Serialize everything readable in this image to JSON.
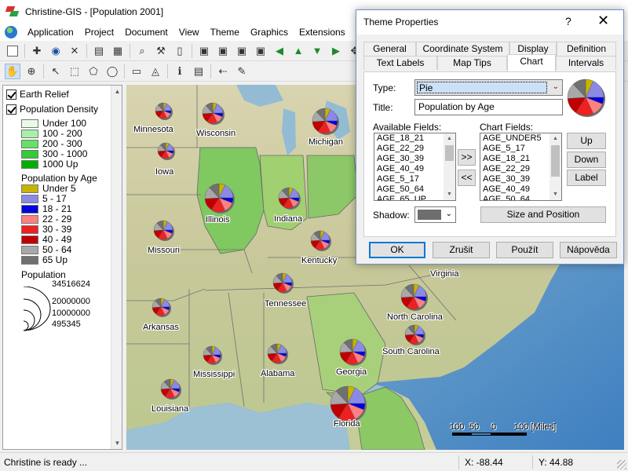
{
  "window": {
    "title": "Christine-GIS - [Population 2001]"
  },
  "menu": [
    "Application",
    "Project",
    "Document",
    "View",
    "Theme",
    "Graphics",
    "Extensions",
    "W"
  ],
  "legend": {
    "layers": [
      {
        "label": "Earth Relief",
        "checked": true
      },
      {
        "label": "Population Density",
        "checked": true
      }
    ],
    "density_classes": [
      {
        "label": "Under 100",
        "color": "#e8fbe8"
      },
      {
        "label": "100 - 200",
        "color": "#a8f0a8"
      },
      {
        "label": "200 - 300",
        "color": "#66e066"
      },
      {
        "label": "300 - 1000",
        "color": "#33cc33"
      },
      {
        "label": "1000 Up",
        "color": "#00b000"
      }
    ],
    "age_title": "Population by Age",
    "age_classes": [
      {
        "label": "Under 5",
        "color": "#c8b400"
      },
      {
        "label": "5 - 17",
        "color": "#8a8ae6"
      },
      {
        "label": "18 - 21",
        "color": "#0000dd"
      },
      {
        "label": "22 - 29",
        "color": "#ff8080"
      },
      {
        "label": "30 - 39",
        "color": "#f02020"
      },
      {
        "label": "40 - 49",
        "color": "#c00000"
      },
      {
        "label": "50 - 64",
        "color": "#a8a8a8"
      },
      {
        "label": "65 Up",
        "color": "#707070"
      }
    ],
    "pop_title": "Population",
    "pop_values": [
      "34516624",
      "20000000",
      "10000000",
      "495345"
    ]
  },
  "map": {
    "states": [
      "Minnesota",
      "Wisconsin",
      "Michigan",
      "Iowa",
      "Illinois",
      "Indiana",
      "Missouri",
      "Kentucky",
      "Virginia",
      "Tennessee",
      "North Carolina",
      "Arkansas",
      "South Carolina",
      "Mississippi",
      "Alabama",
      "Georgia",
      "Louisiana",
      "Florida"
    ],
    "scale_labels": [
      "100",
      "50",
      "0",
      "100 [Miles]"
    ]
  },
  "status": {
    "message": "Christine is ready ...",
    "x": "X: -88.44",
    "y": "Y: 44.88"
  },
  "dialog": {
    "title": "Theme Properties",
    "help": "?",
    "close": "✕",
    "tabs_row1": [
      "General",
      "Coordinate System",
      "Display",
      "Definition"
    ],
    "tabs_row2": [
      "Text Labels",
      "Map Tips",
      "Chart",
      "Intervals"
    ],
    "selected_tab": "Chart",
    "type_label": "Type:",
    "type_value": "Pie",
    "title_label": "Title:",
    "title_value": "Population by Age",
    "available_label": "Available Fields:",
    "available_fields": [
      "AGE_18_21",
      "AGE_22_29",
      "AGE_30_39",
      "AGE_40_49",
      "AGE_5_17",
      "AGE_50_64",
      "AGE_65_UP"
    ],
    "chart_label": "Chart Fields:",
    "chart_fields": [
      "AGE_UNDER5",
      "AGE_5_17",
      "AGE_18_21",
      "AGE_22_29",
      "AGE_30_39",
      "AGE_40_49",
      "AGE_50_64"
    ],
    "add_btn": ">>",
    "remove_btn": "<<",
    "up_btn": "Up",
    "down_btn": "Down",
    "label_btn": "Label",
    "shadow_label": "Shadow:",
    "size_btn": "Size and Position",
    "ok_btn": "OK",
    "cancel_btn": "Zrušit",
    "apply_btn": "Použít",
    "helpbtn": "Nápověda"
  }
}
